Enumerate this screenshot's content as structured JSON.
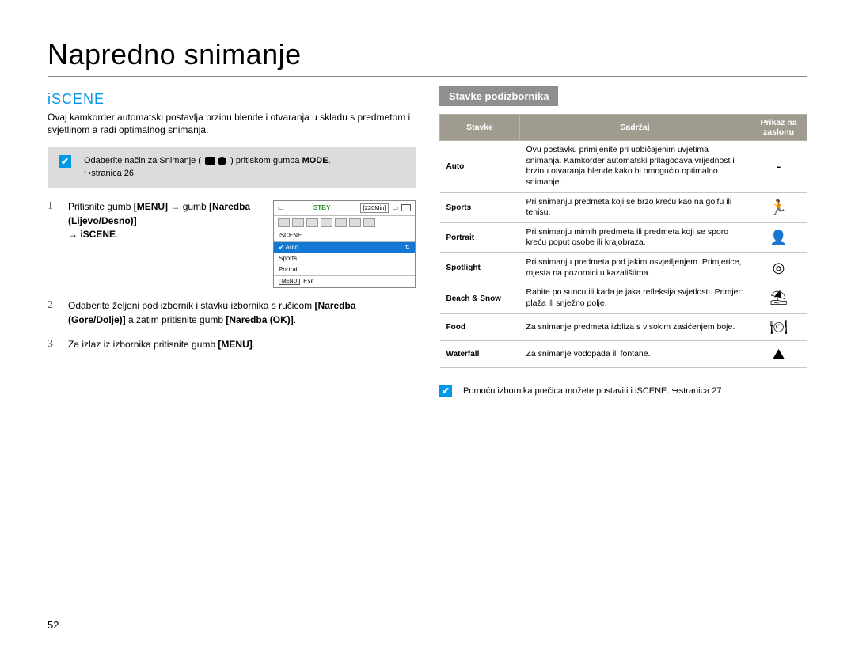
{
  "title": "Napredno snimanje",
  "section_title": "iSCENE",
  "intro": "Ovaj kamkorder automatski postavlja brzinu blende i otvaranja u skladu s predmetom i svjetlinom a radi optimalnog snimanja.",
  "note_box": {
    "pre": "Odaberite način za Snimanje (",
    "mid": ") pritiskom gumba ",
    "mode": "MODE",
    "post": ".",
    "page_ref": "↪stranica 26"
  },
  "steps": [
    {
      "num": "1",
      "parts": [
        "Pritisnite gumb ",
        "[MENU]",
        " → gumb ",
        "[Naredba (Lijevo/Desno)]",
        " → ",
        "iSCENE",
        "."
      ]
    },
    {
      "num": "2",
      "parts": [
        "Odaberite željeni pod izbornik i stavku izbornika s ručicom ",
        "[Naredba (Gore/Dolje)]",
        " a zatim pritisnite gumb ",
        "[Naredba (OK)]",
        "."
      ]
    },
    {
      "num": "3",
      "parts": [
        "Za izlaz iz izbornika pritisnite gumb ",
        "[MENU]",
        "."
      ]
    }
  ],
  "screen": {
    "stby": "STBY",
    "duration": "[220Min]",
    "label": "iSCENE",
    "items": [
      "Auto",
      "Sports",
      "Portrait"
    ],
    "exit_btn": "MENU",
    "exit_text": "Exit"
  },
  "sub_heading": "Stavke podizbornika",
  "table": {
    "headers": [
      "Stavke",
      "Sadržaj",
      "Prikaz na zaslonu"
    ],
    "rows": [
      {
        "item": "Auto",
        "content": "Ovu postavku primijenite pri uobičajenim uvjetima snimanja. Kamkorder automatski prilagođava vrijednost i brzinu otvaranja blende kako bi omogućio optimalno snimanje.",
        "icon": "-"
      },
      {
        "item": "Sports",
        "content": "Pri snimanju predmeta koji se brzo kreću kao na golfu ili tenisu.",
        "icon": "🏃"
      },
      {
        "item": "Portrait",
        "content": "Pri snimanju mirnih predmeta ili predmeta koji se sporo kreću poput osobe ili krajobraza.",
        "icon": "👤"
      },
      {
        "item": "Spotlight",
        "content": "Pri snimanju predmeta pod jakim osvjetljenjem. Primjerice, mjesta na pozornici u kazalištima.",
        "icon": "◎"
      },
      {
        "item": "Beach & Snow",
        "content": "Rabite po suncu ili kada je jaka refleksija svjetlosti. Primjer: plaža ili snježno polje.",
        "icon": "⛱"
      },
      {
        "item": "Food",
        "content": "Za snimanje predmeta izbliza s visokim zasićenjem boje.",
        "icon": "🍽"
      },
      {
        "item": "Waterfall",
        "content": "Za snimanje vodopada ili fontane.",
        "icon": "⛰"
      }
    ]
  },
  "footer_note": {
    "text": "Pomoću izbornika prečica možete postaviti i iSCENE. ↪stranica 27"
  },
  "page_num": "52"
}
